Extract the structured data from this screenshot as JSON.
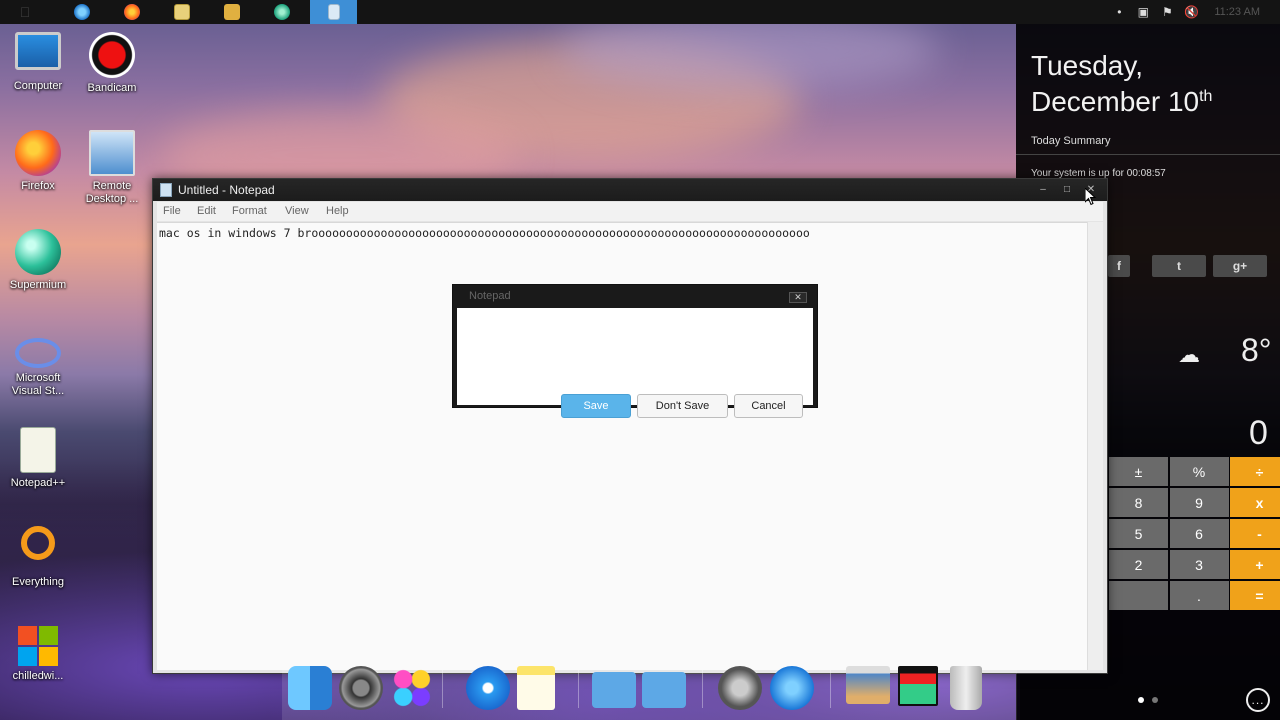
{
  "taskbar": {
    "buttons": [
      {
        "name": "start-button",
        "icon": "start-icon"
      },
      {
        "name": "internet-explorer",
        "icon": "ie-icon"
      },
      {
        "name": "firefox",
        "icon": "firefox-icon"
      },
      {
        "name": "file-explorer",
        "icon": "folder-icon"
      },
      {
        "name": "media-player",
        "icon": "media-player-icon"
      },
      {
        "name": "supermium",
        "icon": "supermium-icon"
      },
      {
        "name": "notepad",
        "icon": "notepad-icon",
        "active": true
      }
    ],
    "tray_icons": [
      "chevron-dot-icon",
      "network-icon",
      "flag-icon",
      "volume-muted-icon"
    ],
    "clock": "11:23 AM"
  },
  "desktop": {
    "icons": [
      {
        "label": "Computer",
        "icon": "computer-icon"
      },
      {
        "label": "Bandicam",
        "icon": "bandicam-icon"
      },
      {
        "label": "Firefox",
        "icon": "firefox-icon"
      },
      {
        "label": "Remote Desktop ...",
        "icon": "remote-desktop-icon"
      },
      {
        "label": "Supermium",
        "icon": "supermium-icon"
      },
      {
        "label": "Microsoft Visual St...",
        "icon": "visual-studio-icon"
      },
      {
        "label": "Notepad++",
        "icon": "notepadpp-icon"
      },
      {
        "label": "Everything",
        "icon": "everything-icon"
      },
      {
        "label": "chilledwi...",
        "icon": "windows-logo-icon"
      }
    ]
  },
  "panel": {
    "day": "Tuesday,",
    "date": "December 10",
    "date_suffix": "th",
    "summary": "Today Summary",
    "uptime": "Your system is up for 00:08:57",
    "social": [
      "f",
      "t",
      "g+"
    ],
    "weather_icon": "cloud-sun-icon",
    "temperature": "8°",
    "calculator": {
      "display": "0",
      "keys": [
        {
          "label": "±",
          "type": "gray"
        },
        {
          "label": "%",
          "type": "gray"
        },
        {
          "label": "÷",
          "type": "orange"
        },
        {
          "label": "8",
          "type": "gray"
        },
        {
          "label": "9",
          "type": "gray"
        },
        {
          "label": "x",
          "type": "orange"
        },
        {
          "label": "5",
          "type": "gray"
        },
        {
          "label": "6",
          "type": "gray"
        },
        {
          "label": "-",
          "type": "orange"
        },
        {
          "label": "2",
          "type": "gray"
        },
        {
          "label": "3",
          "type": "gray"
        },
        {
          "label": "+",
          "type": "orange"
        },
        {
          "label": "",
          "type": "gray"
        },
        {
          "label": ".",
          "type": "gray"
        },
        {
          "label": "=",
          "type": "orange"
        }
      ]
    },
    "more": "..."
  },
  "notepad": {
    "title": "Untitled - Notepad",
    "window_buttons": {
      "minimize": "–",
      "maximize": "□",
      "close": "✕"
    },
    "menu": [
      "File",
      "Edit",
      "Format",
      "View",
      "Help"
    ],
    "content": "mac os in windows 7 broooooooooooooooooooooooooooooooooooooooooooooooooooooooooooooooooooooooo"
  },
  "dialog": {
    "title": "Notepad",
    "close": "✕",
    "buttons": {
      "save": "Save",
      "dont_save": "Don't Save",
      "cancel": "Cancel"
    }
  },
  "dock": {
    "items": [
      "finder-icon",
      "system-preferences-icon",
      "game-center-icon",
      "safari-icon",
      "notes-icon",
      "folder-icon",
      "applications-folder-icon",
      "launchpad-icon",
      "app-store-icon",
      "preview-icon",
      "photo-booth-icon",
      "trash-icon"
    ]
  },
  "colors": {
    "accent": "#3e8fd6",
    "dialog_primary": "#5ab4ea",
    "calc_orange": "#f0a21a",
    "calc_gray": "#6a6a6a"
  }
}
